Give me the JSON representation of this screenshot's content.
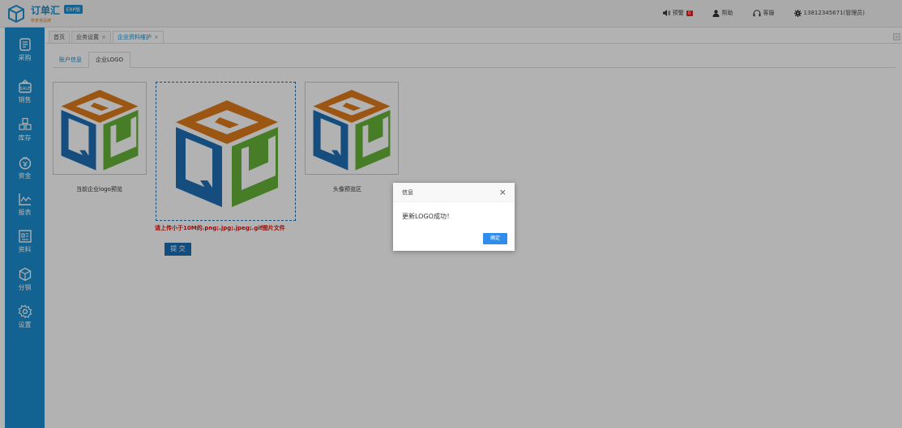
{
  "app": {
    "name": "订单汇",
    "edition": "ERP版",
    "slogan": "管家婆品牌"
  },
  "top_actions": [
    {
      "icon": "speaker-icon",
      "label": "预警",
      "badge": "0"
    },
    {
      "icon": "user-icon",
      "label": "帮助"
    },
    {
      "icon": "headset-icon",
      "label": "客服"
    },
    {
      "icon": "gear-icon",
      "label": "13812345671(管理员)"
    }
  ],
  "sidebar": {
    "items": [
      {
        "icon": "purchase-icon",
        "label": "采购"
      },
      {
        "icon": "sale-icon",
        "label": "销售"
      },
      {
        "icon": "inventory-icon",
        "label": "库存"
      },
      {
        "icon": "money-icon",
        "label": "资金"
      },
      {
        "icon": "report-icon",
        "label": "报表"
      },
      {
        "icon": "data-icon",
        "label": "资料"
      },
      {
        "icon": "distribution-icon",
        "label": "分销"
      },
      {
        "icon": "settings-icon",
        "label": "设置"
      }
    ]
  },
  "tabs": [
    {
      "label": "首页",
      "closable": false
    },
    {
      "label": "业务设置",
      "closable": true
    },
    {
      "label": "企业资料维护",
      "closable": true,
      "active": true
    }
  ],
  "subtabs": [
    {
      "label": "账户信息"
    },
    {
      "label": "企业LOGO",
      "active": true
    }
  ],
  "logo_section": {
    "current_caption": "当前企业logo预览",
    "avatar_caption": "头像预览区",
    "upload_hint": "请上传小于10M的.png;.jpg;.jpeg;.gif图片文件",
    "submit_label": "提 交"
  },
  "dialog": {
    "title": "信息",
    "close_glyph": "×",
    "message": "更新LOGO成功！",
    "confirm_label": "确定"
  },
  "colors": {
    "brand_blue": "#1a8fd0",
    "logo_orange": "#e07b1c",
    "logo_blue": "#1f6fb5",
    "logo_green": "#67b33a",
    "hint_red": "#d61414"
  }
}
